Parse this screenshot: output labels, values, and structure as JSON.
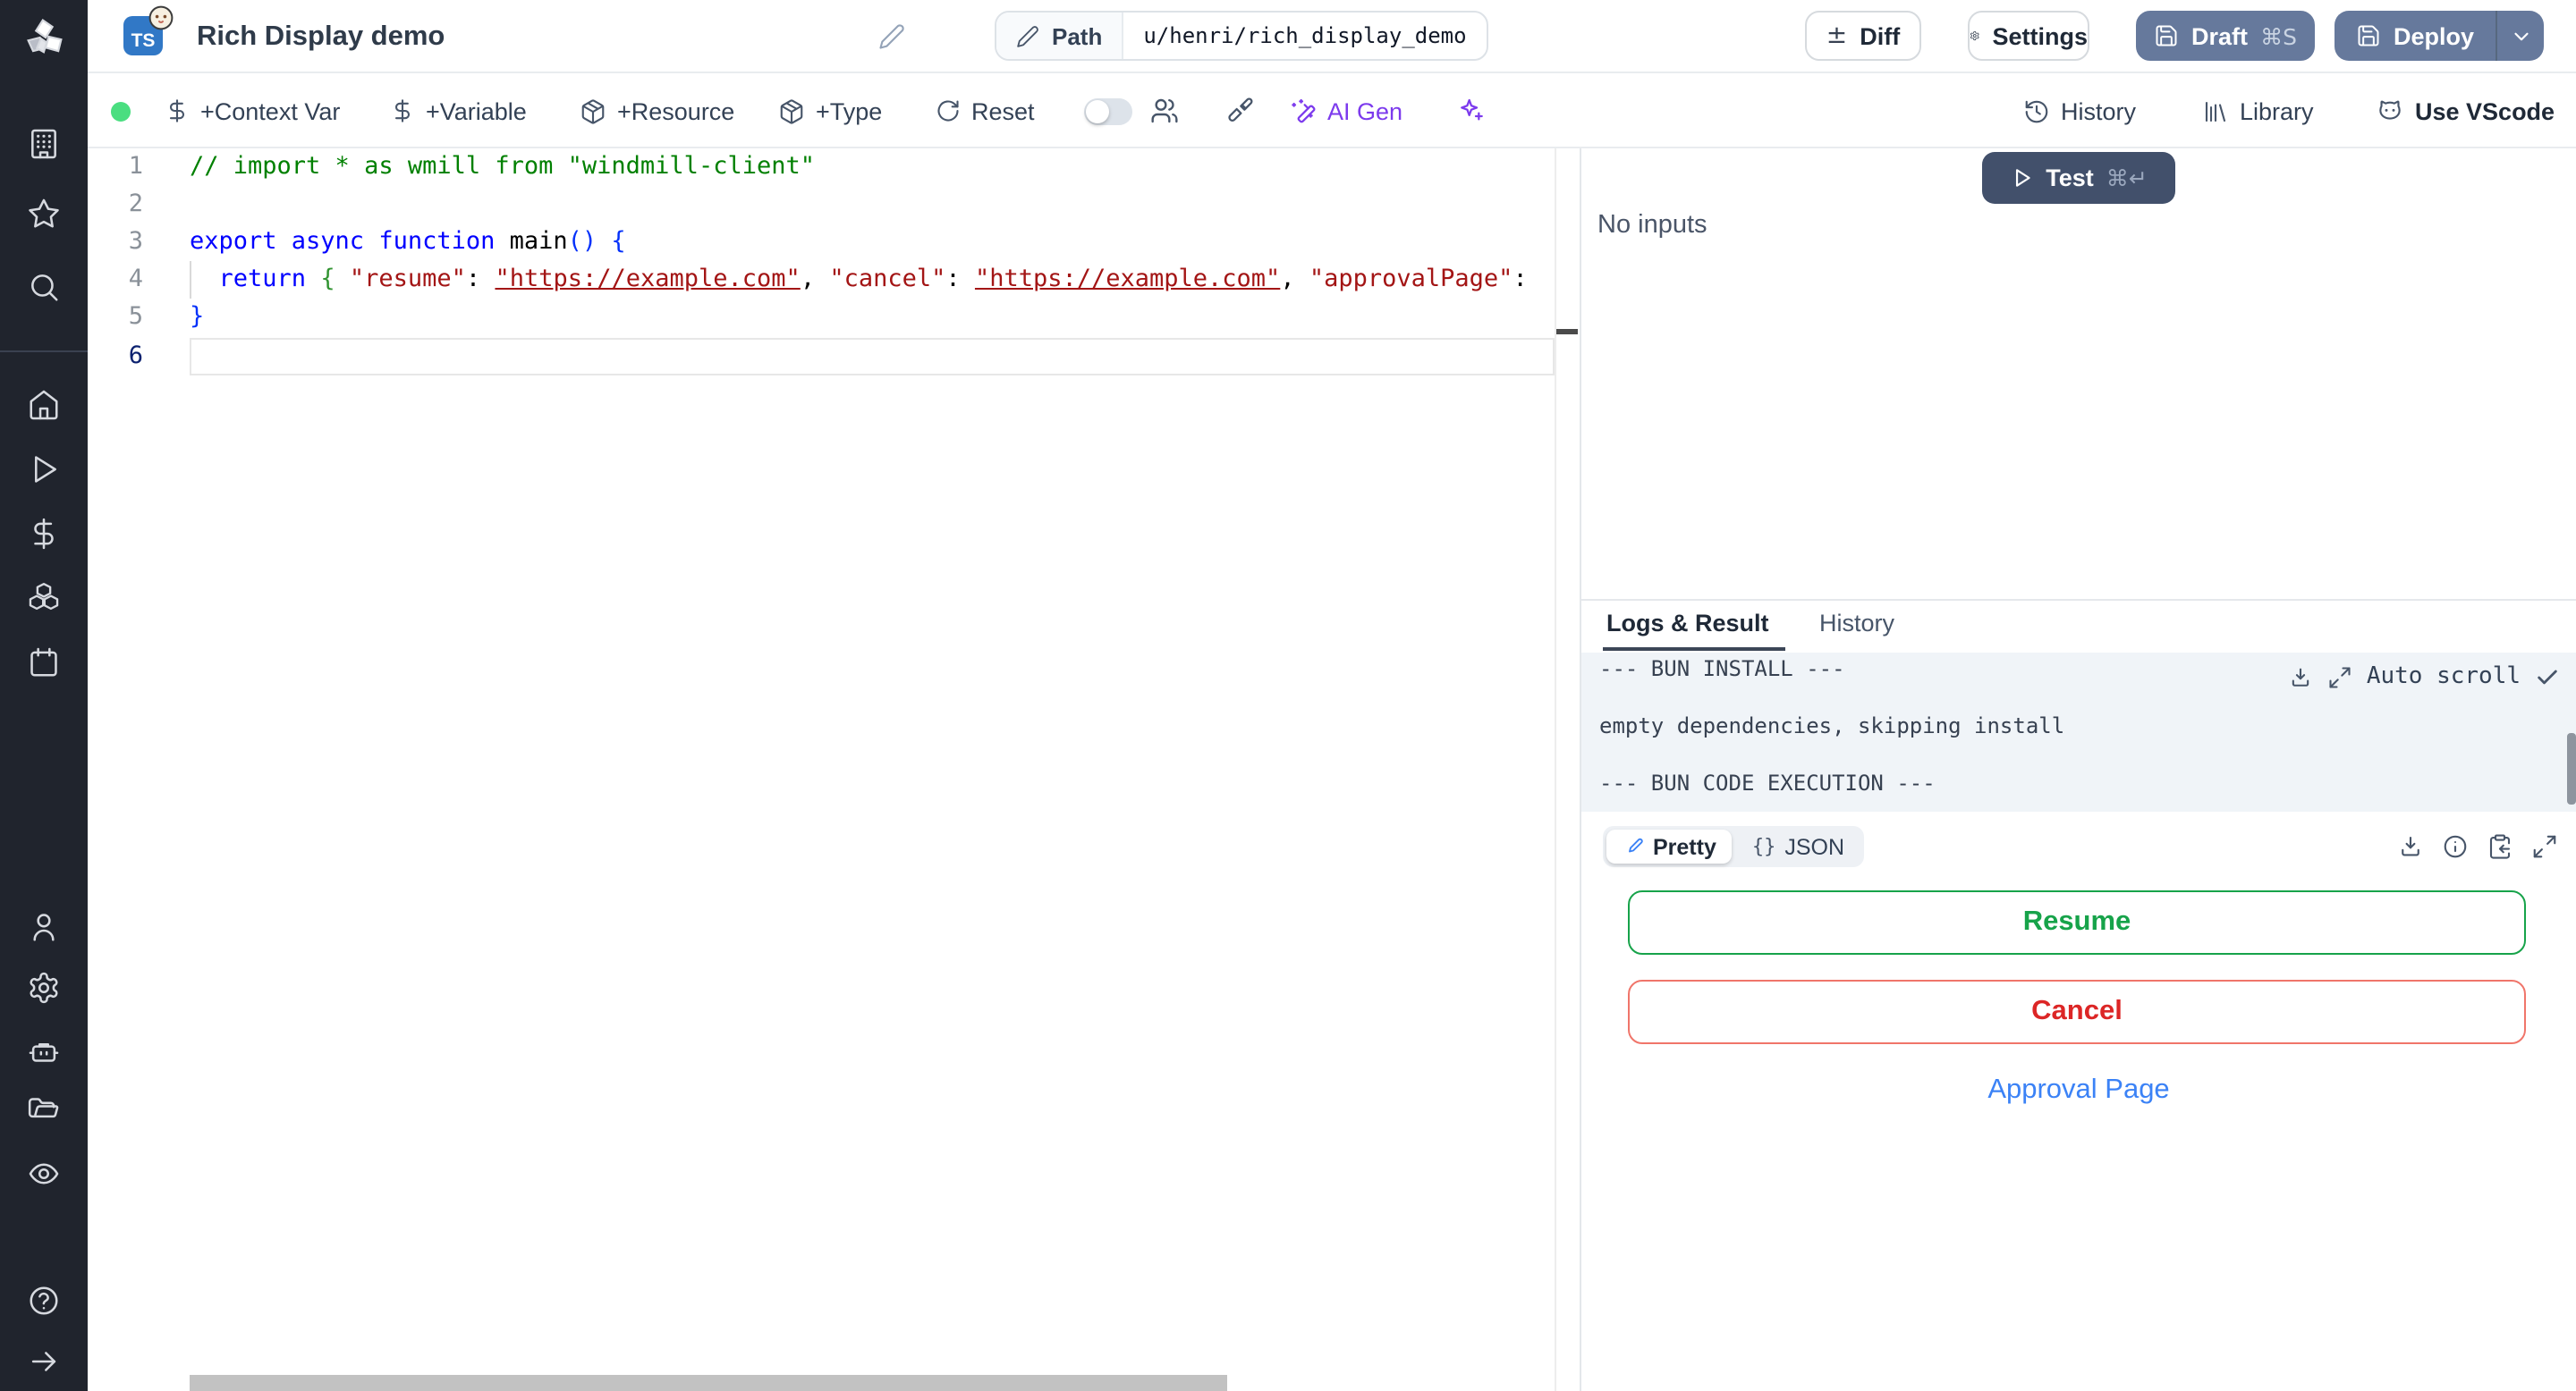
{
  "app": {
    "badge": "TS",
    "title": "Rich Display demo"
  },
  "topbar": {
    "path_label": "Path",
    "path_value": "u/henri/rich_display_demo",
    "diff_label": "Diff",
    "diff_glyph": "±",
    "settings_label": "Settings",
    "draft_label": "Draft",
    "draft_shortcut": "⌘S",
    "deploy_label": "Deploy"
  },
  "toolbar": {
    "context_var": "+Context Var",
    "variable": "+Variable",
    "resource": "+Resource",
    "type": "+Type",
    "reset": "Reset",
    "ai_gen": "AI Gen",
    "history": "History",
    "library": "Library",
    "vscode": "Use VScode"
  },
  "sidebar": {
    "icons": [
      "windmill-logo",
      "building",
      "star",
      "search",
      "home",
      "play",
      "dollar",
      "boxes",
      "calendar",
      "user",
      "settings-gear",
      "robot",
      "folder-open",
      "eye",
      "help-circle",
      "arrow-right"
    ]
  },
  "editor": {
    "line_numbers": [
      "1",
      "2",
      "3",
      "4",
      "5",
      "6"
    ],
    "line1": "// import * as wmill from \"windmill-client\"",
    "line3_kw": "export async function",
    "line3_name": " main",
    "line3_brackets": "() {",
    "line4_kw": "  return ",
    "line4_open": "{ ",
    "line4_key1": "\"resume\"",
    "line4_colon1": ": ",
    "line4_url1": "\"https://example.com\"",
    "line4_comma1": ", ",
    "line4_key2": "\"cancel\"",
    "line4_colon2": ": ",
    "line4_url2": "\"https://example.com\"",
    "line4_comma2": ", ",
    "line4_key3": "\"approvalPage\"",
    "line4_colon3": ":",
    "line5": "}"
  },
  "run_panel": {
    "test_label": "Test",
    "test_shortcut": "⌘↵",
    "no_inputs": "No inputs",
    "tab_logs": "Logs & Result",
    "tab_history": "History",
    "log_lines": [
      "--- BUN INSTALL ---",
      "empty dependencies, skipping install",
      "--- BUN CODE EXECUTION ---"
    ],
    "auto_scroll": "Auto scroll",
    "result": {
      "pretty": "Pretty",
      "json_glyph": "{}",
      "json": "JSON",
      "resume": "Resume",
      "cancel": "Cancel",
      "approval_link": "Approval Page"
    }
  },
  "colors": {
    "ts_blue": "#3178c6",
    "button_slate": "#66799c",
    "test_dark": "#42506b",
    "sidebar_dark": "#20242d",
    "status_green": "#4ade80",
    "resume_green": "#17a34a",
    "cancel_red": "#dc2626",
    "cancel_border": "#f0756a",
    "link_blue": "#3b82f6",
    "ai_purple": "#7c3aed",
    "log_bg": "#f0f4f8"
  }
}
